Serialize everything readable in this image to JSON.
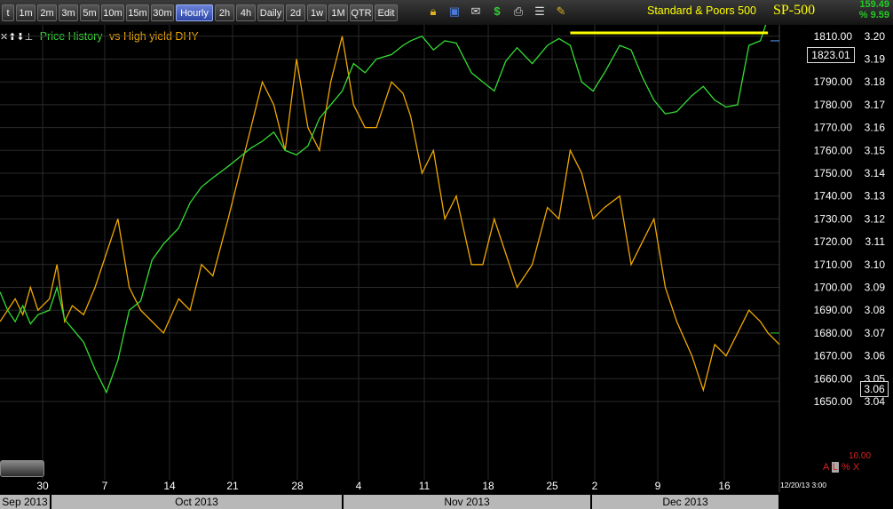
{
  "toolbar": {
    "buttons": [
      "t",
      "1m",
      "2m",
      "3m",
      "5m",
      "10m",
      "15m",
      "30m",
      "Hourly",
      "2h",
      "4h",
      "Daily",
      "2d",
      "1w",
      "1M",
      "QTR",
      "Edit"
    ],
    "active": "Hourly",
    "icons": [
      "lock-icon",
      "save-icon",
      "mail-icon",
      "dollar-icon",
      "print-icon",
      "form-icon",
      "pencil-icon"
    ]
  },
  "symbol": {
    "name": "Standard & Poors 500",
    "ticker": "SP-500",
    "change": "159.49",
    "change_pct": "% 9.59"
  },
  "legend": {
    "controls": "✕⬆⬇⊥",
    "price_label": "Price History",
    "compare_label": "vs High yield DHY"
  },
  "price_box": "1823.01",
  "yield_box": "3.06",
  "date_label": "12/20/13 3:00",
  "scale_value": "10.00",
  "alx": {
    "a": "A",
    "l": "L",
    "pct": "%",
    "x": "X"
  },
  "colors": {
    "price": "#33dd33",
    "compare": "#f0a800",
    "resistance": "#ffff00",
    "grid": "#2a2a2a"
  },
  "months": [
    {
      "label": "Sep 2013"
    },
    {
      "label": "Oct 2013"
    },
    {
      "label": "Nov 2013"
    },
    {
      "label": "Dec 2013"
    }
  ],
  "chart_data": {
    "type": "line",
    "x_ticks": [
      "30",
      "7",
      "14",
      "21",
      "28",
      "4",
      "11",
      "18",
      "25",
      "2",
      "9",
      "16"
    ],
    "y_axis_price": {
      "ticks": [
        1650,
        1660,
        1670,
        1680,
        1690,
        1700,
        1710,
        1720,
        1730,
        1740,
        1750,
        1760,
        1770,
        1780,
        1790,
        1800,
        1810
      ],
      "range": [
        1642,
        1822
      ]
    },
    "y_axis_yield": {
      "ticks": [
        3.04,
        3.05,
        3.06,
        3.07,
        3.08,
        3.09,
        3.1,
        3.11,
        3.12,
        3.13,
        3.14,
        3.15,
        3.16,
        3.17,
        3.18,
        3.19,
        3.2
      ],
      "range": [
        3.035,
        3.205
      ]
    },
    "series": [
      {
        "name": "Price History",
        "axis": "price",
        "x": [
          0,
          2,
          4,
          6,
          8,
          10,
          13,
          15,
          17,
          19,
          22,
          25,
          28,
          31,
          34,
          37,
          40,
          43,
          47,
          50,
          53,
          56,
          60,
          63,
          66,
          69,
          72,
          75,
          78,
          81,
          84,
          87,
          90,
          93,
          96,
          99,
          103,
          106,
          108,
          111,
          114,
          117,
          120,
          124,
          127,
          130,
          133,
          136,
          140,
          144,
          147,
          150,
          153,
          156,
          159,
          163,
          166,
          169,
          172,
          175,
          178,
          182,
          185,
          188,
          191,
          194,
          197,
          200,
          202,
          205
        ],
        "y": [
          1698,
          1690,
          1685,
          1692,
          1684,
          1688,
          1690,
          1700,
          1686,
          1682,
          1676,
          1664,
          1654,
          1668,
          1690,
          1694,
          1712,
          1719,
          1726,
          1737,
          1744,
          1748,
          1753,
          1757,
          1761,
          1764,
          1768,
          1760,
          1758,
          1762,
          1774,
          1780,
          1786,
          1798,
          1794,
          1800,
          1802,
          1806,
          1808,
          1810,
          1804,
          1808,
          1807,
          1794,
          1790,
          1786,
          1799,
          1805,
          1798,
          1806,
          1809,
          1806,
          1790,
          1786,
          1794,
          1806,
          1804,
          1792,
          1782,
          1776,
          1777,
          1784,
          1788,
          1782,
          1779,
          1780,
          1806,
          1808,
          1818,
          1822
        ]
      },
      {
        "name": "vs High yield DHY",
        "axis": "yield",
        "x": [
          0,
          2,
          4,
          6,
          8,
          10,
          13,
          15,
          17,
          19,
          22,
          25,
          28,
          31,
          34,
          37,
          40,
          43,
          47,
          50,
          53,
          56,
          60,
          63,
          66,
          69,
          72,
          75,
          78,
          81,
          84,
          87,
          90,
          93,
          96,
          99,
          103,
          106,
          108,
          111,
          114,
          117,
          120,
          124,
          127,
          130,
          133,
          136,
          140,
          144,
          147,
          150,
          153,
          156,
          159,
          163,
          166,
          169,
          172,
          175,
          178,
          182,
          185,
          188,
          191,
          194,
          197,
          200,
          202,
          205
        ],
        "y": [
          3.075,
          3.08,
          3.085,
          3.078,
          3.09,
          3.08,
          3.085,
          3.1,
          3.075,
          3.082,
          3.078,
          3.09,
          3.105,
          3.12,
          3.09,
          3.08,
          3.075,
          3.07,
          3.085,
          3.08,
          3.1,
          3.095,
          3.12,
          3.14,
          3.16,
          3.18,
          3.17,
          3.15,
          3.19,
          3.16,
          3.15,
          3.18,
          3.2,
          3.17,
          3.16,
          3.16,
          3.18,
          3.175,
          3.165,
          3.14,
          3.15,
          3.12,
          3.13,
          3.1,
          3.1,
          3.12,
          3.105,
          3.09,
          3.1,
          3.125,
          3.12,
          3.15,
          3.14,
          3.12,
          3.125,
          3.13,
          3.1,
          3.11,
          3.12,
          3.09,
          3.075,
          3.06,
          3.045,
          3.065,
          3.06,
          3.07,
          3.08,
          3.075,
          3.07,
          3.065
        ]
      }
    ],
    "resistance": {
      "axis": "price",
      "y": 1811.5,
      "x_range": [
        150,
        202
      ]
    }
  }
}
